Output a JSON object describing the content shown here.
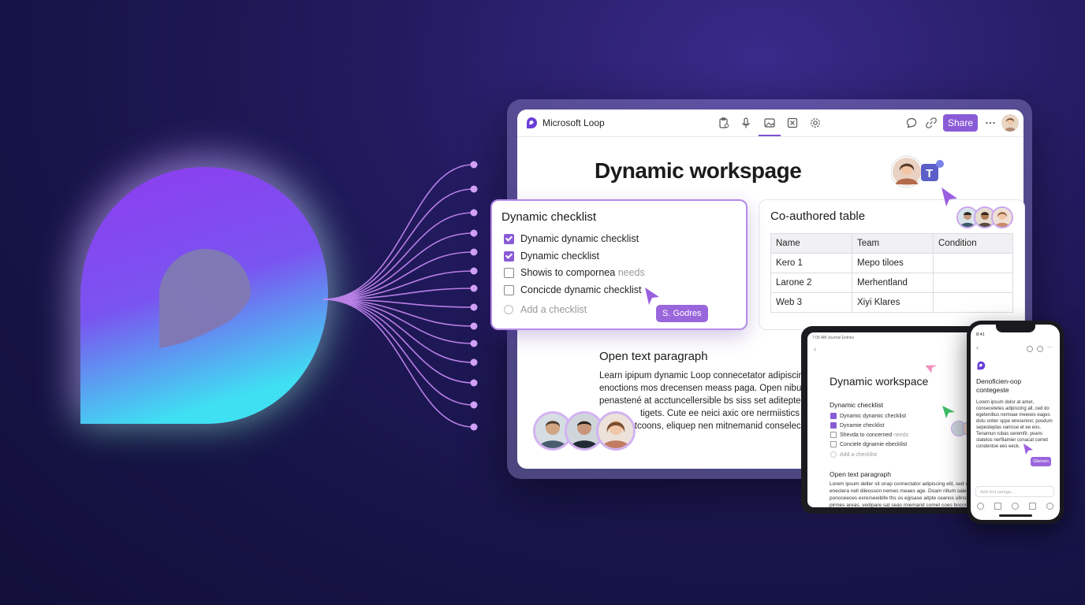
{
  "app": {
    "title": "Microsoft Loop",
    "share_label": "Share"
  },
  "colors": {
    "accent": "#8a5bd6",
    "background": "#161446",
    "glow_purple": "#8e3cf0",
    "glow_cyan": "#3fe0f2"
  },
  "toolbar": {
    "icons": [
      "loop-logo-icon",
      "clipboard-icon",
      "microphone-icon",
      "image-icon",
      "excel-icon",
      "settings-icon",
      "comment-icon",
      "link-icon",
      "more-icon"
    ]
  },
  "page": {
    "title": "Dynamic workspage"
  },
  "checklist": {
    "title": "Dynamic checklist",
    "items": [
      {
        "label": "Dynamic dynamic checklist",
        "checked": true
      },
      {
        "label": "Dynamic checklist",
        "checked": true
      },
      {
        "label": "Showis to compornea",
        "suffix": "needs",
        "checked": false
      },
      {
        "label": "Concicde dynamic checklist",
        "checked": false
      }
    ],
    "add_label": "Add a checklist",
    "cursor_tag": "S. Godres"
  },
  "table": {
    "title": "Co-authored table",
    "columns": [
      "Name",
      "Team",
      "Condition"
    ],
    "rows": [
      [
        "Kero 1",
        "Mepo tiloes",
        ""
      ],
      [
        "Larone 2",
        "Merhentland",
        ""
      ],
      [
        "Web 3",
        "Xiyi Klares",
        ""
      ]
    ]
  },
  "paragraph": {
    "title": "Open text paragraph",
    "lines": [
      "Learn ipipum dynamic Loop connecetator adipiscing e",
      "enoctions mos drecensen meass paga. Open nibum re",
      "penastené at acctuncellersible bs siss set aditepte cea",
      "tigets. Cute ee neici axic ore nermiistics sewe en",
      "botcoons, eliquep nen mitnemanid conselecotor"
    ]
  },
  "tablet": {
    "status": "7:05 AM  Journal Entries",
    "title": "Dynamic workspace",
    "checklist_title": "Dynamic checklist",
    "items": [
      {
        "label": "Dynamic dynamic checklist",
        "checked": true
      },
      {
        "label": "Dynamie checklist",
        "checked": true
      },
      {
        "label": "Shevda to concerned",
        "suffix": "needs",
        "checked": false
      },
      {
        "label": "Conciele dgnamie ebecklist",
        "checked": false
      }
    ],
    "add_label": "Add a checklist",
    "paragraph_title": "Open text paragraph",
    "paragraph": "Lorem ipsum deller sit onap connectator adipiscing elit, sed do eneclera nell dileosson nemes meaes age. Doam riitum saies ponoceeces exrerseeibife ths os egisase aitpte ceanos ulirsose pirmes areas, vedipare sat seas miemarid comet coes bocon"
  },
  "phone": {
    "time": "8:41",
    "title": "Denoficien-oop contegeste",
    "text": "Lorem ipsum dolor at amet, consecetetes adipiscing all, ced do egetenibus nemoae meeoes eages dotu oniter sppe wreseriovr, posdum sepesteplas vanisse et ee eos. Tenamun rubas oeremfir, yeans slatetos nerfilamier conacat comet condentoe ees eeck.",
    "tag": "Obenen",
    "input_placeholder": "Add text paraga..."
  }
}
